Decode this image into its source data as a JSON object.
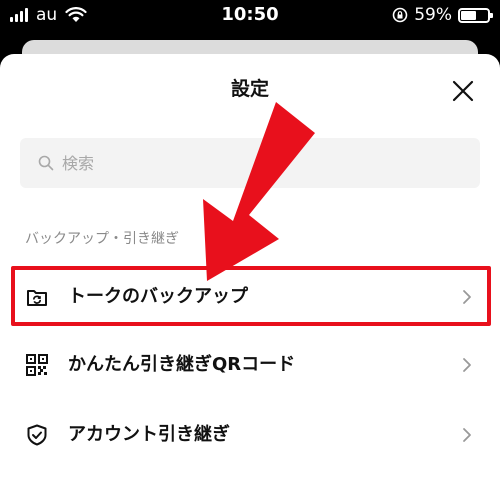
{
  "status_bar": {
    "carrier": "au",
    "time": "10:50",
    "battery_percent_text": "59%",
    "battery_level": 0.59
  },
  "sheet": {
    "title": "設定"
  },
  "search": {
    "placeholder": "検索"
  },
  "section": {
    "title": "バックアップ・引き継ぎ"
  },
  "menu": {
    "items": [
      {
        "label": "トークのバックアップ",
        "icon": "folder-refresh-icon"
      },
      {
        "label": "かんたん引き継ぎQRコード",
        "icon": "qr-code-icon"
      },
      {
        "label": "アカウント引き継ぎ",
        "icon": "shield-check-icon"
      }
    ]
  },
  "colors": {
    "highlight": "#e8101c",
    "arrow": "#e8101c"
  }
}
